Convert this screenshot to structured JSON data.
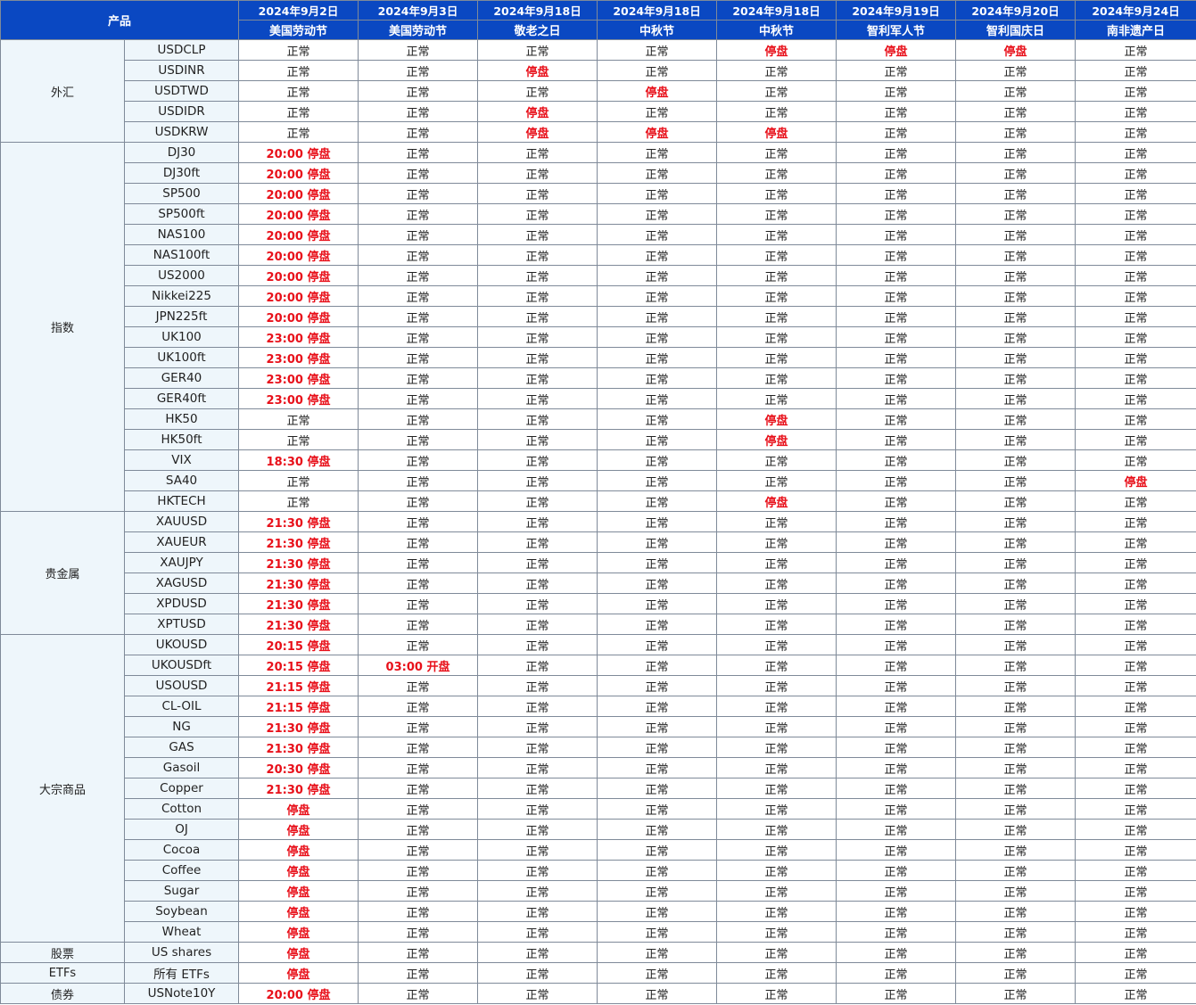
{
  "header": {
    "product_label": "产品",
    "dates": [
      "2024年9月2日",
      "2024年9月3日",
      "2024年9月18日",
      "2024年9月18日",
      "2024年9月18日",
      "2024年9月19日",
      "2024年9月20日",
      "2024年9月24日"
    ],
    "holidays": [
      "美国劳动节",
      "美国劳动节",
      "敬老之日",
      "中秋节",
      "中秋节",
      "智利军人节",
      "智利国庆日",
      "南非遗产日"
    ]
  },
  "colors": {
    "header_bg": "#0a48c2",
    "header_text": "#ffffff",
    "label_bg": "#eef6fb",
    "closed_text": "#e8101a",
    "normal_text": "#222222"
  },
  "groups": [
    {
      "category": "外汇",
      "rows": [
        {
          "product": "USDCLP",
          "cells": [
            "正常",
            "正常",
            "正常",
            "正常",
            "停盘",
            "停盘",
            "停盘",
            "正常"
          ]
        },
        {
          "product": "USDINR",
          "cells": [
            "正常",
            "正常",
            "停盘",
            "正常",
            "正常",
            "正常",
            "正常",
            "正常"
          ]
        },
        {
          "product": "USDTWD",
          "cells": [
            "正常",
            "正常",
            "正常",
            "停盘",
            "正常",
            "正常",
            "正常",
            "正常"
          ]
        },
        {
          "product": "USDIDR",
          "cells": [
            "正常",
            "正常",
            "停盘",
            "正常",
            "正常",
            "正常",
            "正常",
            "正常"
          ]
        },
        {
          "product": "USDKRW",
          "cells": [
            "正常",
            "正常",
            "停盘",
            "停盘",
            "停盘",
            "正常",
            "正常",
            "正常"
          ]
        }
      ]
    },
    {
      "category": "指数",
      "rows": [
        {
          "product": "DJ30",
          "cells": [
            "20:00 停盘",
            "正常",
            "正常",
            "正常",
            "正常",
            "正常",
            "正常",
            "正常"
          ]
        },
        {
          "product": "DJ30ft",
          "cells": [
            "20:00 停盘",
            "正常",
            "正常",
            "正常",
            "正常",
            "正常",
            "正常",
            "正常"
          ]
        },
        {
          "product": "SP500",
          "cells": [
            "20:00 停盘",
            "正常",
            "正常",
            "正常",
            "正常",
            "正常",
            "正常",
            "正常"
          ]
        },
        {
          "product": "SP500ft",
          "cells": [
            "20:00 停盘",
            "正常",
            "正常",
            "正常",
            "正常",
            "正常",
            "正常",
            "正常"
          ]
        },
        {
          "product": "NAS100",
          "cells": [
            "20:00 停盘",
            "正常",
            "正常",
            "正常",
            "正常",
            "正常",
            "正常",
            "正常"
          ]
        },
        {
          "product": "NAS100ft",
          "cells": [
            "20:00 停盘",
            "正常",
            "正常",
            "正常",
            "正常",
            "正常",
            "正常",
            "正常"
          ]
        },
        {
          "product": "US2000",
          "cells": [
            "20:00 停盘",
            "正常",
            "正常",
            "正常",
            "正常",
            "正常",
            "正常",
            "正常"
          ]
        },
        {
          "product": "Nikkei225",
          "cells": [
            "20:00 停盘",
            "正常",
            "正常",
            "正常",
            "正常",
            "正常",
            "正常",
            "正常"
          ]
        },
        {
          "product": "JPN225ft",
          "cells": [
            "20:00 停盘",
            "正常",
            "正常",
            "正常",
            "正常",
            "正常",
            "正常",
            "正常"
          ]
        },
        {
          "product": "UK100",
          "cells": [
            "23:00 停盘",
            "正常",
            "正常",
            "正常",
            "正常",
            "正常",
            "正常",
            "正常"
          ]
        },
        {
          "product": "UK100ft",
          "cells": [
            "23:00 停盘",
            "正常",
            "正常",
            "正常",
            "正常",
            "正常",
            "正常",
            "正常"
          ]
        },
        {
          "product": "GER40",
          "cells": [
            "23:00 停盘",
            "正常",
            "正常",
            "正常",
            "正常",
            "正常",
            "正常",
            "正常"
          ]
        },
        {
          "product": "GER40ft",
          "cells": [
            "23:00 停盘",
            "正常",
            "正常",
            "正常",
            "正常",
            "正常",
            "正常",
            "正常"
          ]
        },
        {
          "product": "HK50",
          "cells": [
            "正常",
            "正常",
            "正常",
            "正常",
            "停盘",
            "正常",
            "正常",
            "正常"
          ]
        },
        {
          "product": "HK50ft",
          "cells": [
            "正常",
            "正常",
            "正常",
            "正常",
            "停盘",
            "正常",
            "正常",
            "正常"
          ]
        },
        {
          "product": "VIX",
          "cells": [
            "18:30 停盘",
            "正常",
            "正常",
            "正常",
            "正常",
            "正常",
            "正常",
            "正常"
          ]
        },
        {
          "product": "SA40",
          "cells": [
            "正常",
            "正常",
            "正常",
            "正常",
            "正常",
            "正常",
            "正常",
            "停盘"
          ]
        },
        {
          "product": "HKTECH",
          "cells": [
            "正常",
            "正常",
            "正常",
            "正常",
            "停盘",
            "正常",
            "正常",
            "正常"
          ]
        }
      ]
    },
    {
      "category": "贵金属",
      "rows": [
        {
          "product": "XAUUSD",
          "cells": [
            "21:30 停盘",
            "正常",
            "正常",
            "正常",
            "正常",
            "正常",
            "正常",
            "正常"
          ]
        },
        {
          "product": "XAUEUR",
          "cells": [
            "21:30 停盘",
            "正常",
            "正常",
            "正常",
            "正常",
            "正常",
            "正常",
            "正常"
          ]
        },
        {
          "product": "XAUJPY",
          "cells": [
            "21:30 停盘",
            "正常",
            "正常",
            "正常",
            "正常",
            "正常",
            "正常",
            "正常"
          ]
        },
        {
          "product": "XAGUSD",
          "cells": [
            "21:30 停盘",
            "正常",
            "正常",
            "正常",
            "正常",
            "正常",
            "正常",
            "正常"
          ]
        },
        {
          "product": "XPDUSD",
          "cells": [
            "21:30 停盘",
            "正常",
            "正常",
            "正常",
            "正常",
            "正常",
            "正常",
            "正常"
          ]
        },
        {
          "product": "XPTUSD",
          "cells": [
            "21:30 停盘",
            "正常",
            "正常",
            "正常",
            "正常",
            "正常",
            "正常",
            "正常"
          ]
        }
      ]
    },
    {
      "category": "大宗商品",
      "rows": [
        {
          "product": "UKOUSD",
          "cells": [
            "20:15 停盘",
            "正常",
            "正常",
            "正常",
            "正常",
            "正常",
            "正常",
            "正常"
          ]
        },
        {
          "product": "UKOUSDft",
          "cells": [
            "20:15 停盘",
            "03:00 开盘",
            "正常",
            "正常",
            "正常",
            "正常",
            "正常",
            "正常"
          ]
        },
        {
          "product": "USOUSD",
          "cells": [
            "21:15 停盘",
            "正常",
            "正常",
            "正常",
            "正常",
            "正常",
            "正常",
            "正常"
          ]
        },
        {
          "product": "CL-OIL",
          "cells": [
            "21:15 停盘",
            "正常",
            "正常",
            "正常",
            "正常",
            "正常",
            "正常",
            "正常"
          ]
        },
        {
          "product": "NG",
          "cells": [
            "21:30 停盘",
            "正常",
            "正常",
            "正常",
            "正常",
            "正常",
            "正常",
            "正常"
          ]
        },
        {
          "product": "GAS",
          "cells": [
            "21:30 停盘",
            "正常",
            "正常",
            "正常",
            "正常",
            "正常",
            "正常",
            "正常"
          ]
        },
        {
          "product": "Gasoil",
          "cells": [
            "20:30 停盘",
            "正常",
            "正常",
            "正常",
            "正常",
            "正常",
            "正常",
            "正常"
          ]
        },
        {
          "product": "Copper",
          "cells": [
            "21:30 停盘",
            "正常",
            "正常",
            "正常",
            "正常",
            "正常",
            "正常",
            "正常"
          ]
        },
        {
          "product": "Cotton",
          "cells": [
            "停盘",
            "正常",
            "正常",
            "正常",
            "正常",
            "正常",
            "正常",
            "正常"
          ]
        },
        {
          "product": "OJ",
          "cells": [
            "停盘",
            "正常",
            "正常",
            "正常",
            "正常",
            "正常",
            "正常",
            "正常"
          ]
        },
        {
          "product": "Cocoa",
          "cells": [
            "停盘",
            "正常",
            "正常",
            "正常",
            "正常",
            "正常",
            "正常",
            "正常"
          ]
        },
        {
          "product": "Coffee",
          "cells": [
            "停盘",
            "正常",
            "正常",
            "正常",
            "正常",
            "正常",
            "正常",
            "正常"
          ]
        },
        {
          "product": "Sugar",
          "cells": [
            "停盘",
            "正常",
            "正常",
            "正常",
            "正常",
            "正常",
            "正常",
            "正常"
          ]
        },
        {
          "product": "Soybean",
          "cells": [
            "停盘",
            "正常",
            "正常",
            "正常",
            "正常",
            "正常",
            "正常",
            "正常"
          ]
        },
        {
          "product": "Wheat",
          "cells": [
            "停盘",
            "正常",
            "正常",
            "正常",
            "正常",
            "正常",
            "正常",
            "正常"
          ]
        }
      ]
    },
    {
      "category": "股票",
      "rows": [
        {
          "product": "US shares",
          "cells": [
            "停盘",
            "正常",
            "正常",
            "正常",
            "正常",
            "正常",
            "正常",
            "正常"
          ]
        }
      ]
    },
    {
      "category": "ETFs",
      "rows": [
        {
          "product": "所有 ETFs",
          "cells": [
            "停盘",
            "正常",
            "正常",
            "正常",
            "正常",
            "正常",
            "正常",
            "正常"
          ]
        }
      ]
    },
    {
      "category": "债券",
      "rows": [
        {
          "product": "USNote10Y",
          "cells": [
            "20:00 停盘",
            "正常",
            "正常",
            "正常",
            "正常",
            "正常",
            "正常",
            "正常"
          ]
        }
      ]
    }
  ]
}
